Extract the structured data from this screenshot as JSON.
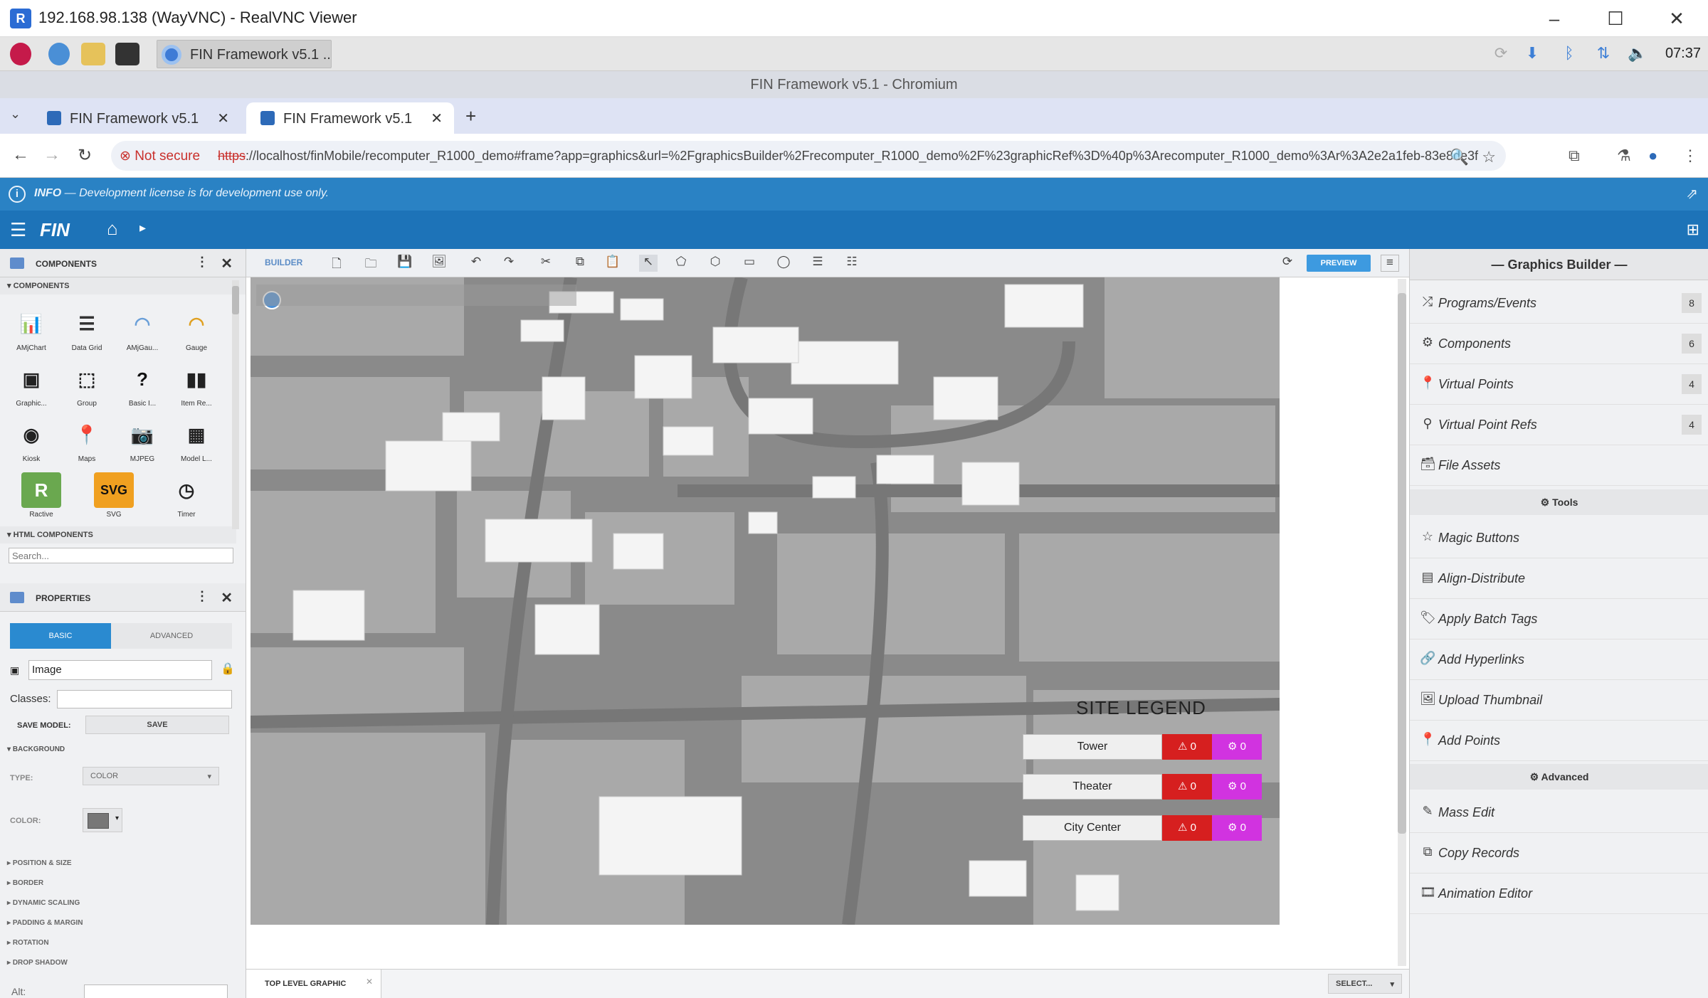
{
  "vnc": {
    "title": "192.168.98.138 (WayVNC) - RealVNC Viewer",
    "logo": "R"
  },
  "taskbar": {
    "app_label": "FIN Framework v5.1 ..",
    "clock": "07:37"
  },
  "browser": {
    "window_title": "FIN Framework v5.1 - Chromium",
    "tabs": [
      {
        "label": "FIN Framework v5.1"
      },
      {
        "label": "FIN Framework v5.1"
      }
    ],
    "security": "Not secure",
    "url_scheme": "https",
    "url_rest": "://localhost/finMobile/recomputer_R1000_demo#frame?app=graphics&url=%2FgraphicsBuilder%2Frecomputer_R1000_demo%2F%23graphicRef%3D%40p%3Arecomputer_R1000_demo%3Ar%3A2e2a1feb-83e8de3f"
  },
  "info": {
    "prefix": "INFO",
    "message": "— Development license is for development use only."
  },
  "fin": {
    "logo": "FIN"
  },
  "components_panel": {
    "title": "COMPONENTS",
    "section": "COMPONENTS",
    "items": [
      {
        "label": "AMjChart",
        "icon": "bar-chart-icon"
      },
      {
        "label": "Data Grid",
        "icon": "grid-icon"
      },
      {
        "label": "AMjGau...",
        "icon": "gauge-icon"
      },
      {
        "label": "Gauge",
        "icon": "gauge-icon"
      },
      {
        "label": "Graphic...",
        "icon": "graphic-icon"
      },
      {
        "label": "Group",
        "icon": "group-icon"
      },
      {
        "label": "Basic I...",
        "icon": "help-icon"
      },
      {
        "label": "Item Re...",
        "icon": "repeater-icon"
      },
      {
        "label": "Kiosk",
        "icon": "kiosk-icon"
      },
      {
        "label": "Maps",
        "icon": "map-icon"
      },
      {
        "label": "MJPEG",
        "icon": "camera-icon"
      },
      {
        "label": "Model L...",
        "icon": "layout-icon"
      },
      {
        "label": "Ractive",
        "icon": "ractive-icon"
      },
      {
        "label": "SVG",
        "icon": "svg-icon"
      },
      {
        "label": "Timer",
        "icon": "clock-icon"
      }
    ],
    "html_section": "HTML COMPONENTS",
    "search_placeholder": "Search..."
  },
  "properties_panel": {
    "title": "PROPERTIES",
    "tabs": [
      "BASIC",
      "ADVANCED"
    ],
    "name_value": "Image",
    "classes_label": "Classes:",
    "save_model_label": "SAVE MODEL:",
    "save_label": "SAVE",
    "background_section": "BACKGROUND",
    "type_label": "TYPE:",
    "type_value": "COLOR",
    "color_label": "COLOR:",
    "color_value": "#777777",
    "sections": [
      "POSITION & SIZE",
      "BORDER",
      "DYNAMIC SCALING",
      "PADDING & MARGIN",
      "ROTATION",
      "DROP SHADOW"
    ],
    "alt_label": "Alt:"
  },
  "builder": {
    "label": "BUILDER",
    "preview_label": "PREVIEW"
  },
  "legend": {
    "title": "SITE LEGEND",
    "rows": [
      {
        "name": "Tower",
        "alarms": "0",
        "other": "0"
      },
      {
        "name": "Theater",
        "alarms": "0",
        "other": "0"
      },
      {
        "name": "City Center",
        "alarms": "0",
        "other": "0"
      }
    ]
  },
  "graphics_builder": {
    "title": "— Graphics Builder —",
    "items": [
      {
        "label": "Programs/Events",
        "count": "8",
        "icon": "shuffle-icon"
      },
      {
        "label": "Components",
        "count": "6",
        "icon": "gear-icon"
      },
      {
        "label": "Virtual Points",
        "count": "4",
        "icon": "pin-icon"
      },
      {
        "label": "Virtual Point Refs",
        "count": "4",
        "icon": "pin-outline-icon"
      },
      {
        "label": "File Assets",
        "count": "",
        "icon": "archive-icon"
      }
    ],
    "tools_title": "Tools",
    "tools": [
      {
        "label": "Magic Buttons",
        "icon": "star-icon"
      },
      {
        "label": "Align-Distribute",
        "icon": "align-icon"
      },
      {
        "label": "Apply Batch Tags",
        "icon": "tag-icon"
      },
      {
        "label": "Add Hyperlinks",
        "icon": "link-icon"
      },
      {
        "label": "Upload Thumbnail",
        "icon": "image-icon"
      },
      {
        "label": "Add Points",
        "icon": "pin-icon"
      }
    ],
    "advanced_title": "Advanced",
    "advanced": [
      {
        "label": "Mass Edit",
        "icon": "edit-icon"
      },
      {
        "label": "Copy Records",
        "icon": "copy-icon"
      },
      {
        "label": "Animation Editor",
        "icon": "film-icon"
      }
    ]
  },
  "bottom": {
    "tab_label": "TOP LEVEL GRAPHIC",
    "select_label": "SELECT..."
  }
}
